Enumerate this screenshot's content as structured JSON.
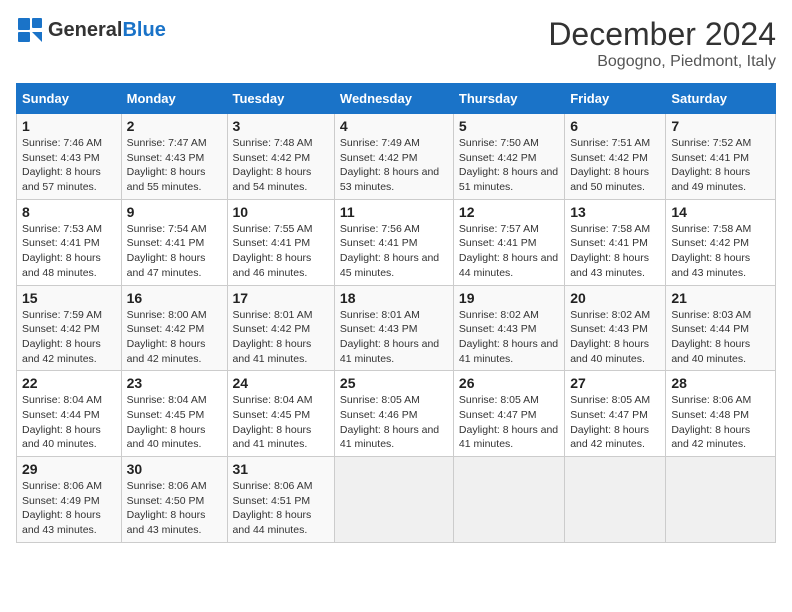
{
  "logo": {
    "text_general": "General",
    "text_blue": "Blue"
  },
  "title": "December 2024",
  "subtitle": "Bogogno, Piedmont, Italy",
  "weekdays": [
    "Sunday",
    "Monday",
    "Tuesday",
    "Wednesday",
    "Thursday",
    "Friday",
    "Saturday"
  ],
  "weeks": [
    [
      {
        "day": "1",
        "sunrise": "7:46 AM",
        "sunset": "4:43 PM",
        "daylight": "8 hours and 57 minutes."
      },
      {
        "day": "2",
        "sunrise": "7:47 AM",
        "sunset": "4:43 PM",
        "daylight": "8 hours and 55 minutes."
      },
      {
        "day": "3",
        "sunrise": "7:48 AM",
        "sunset": "4:42 PM",
        "daylight": "8 hours and 54 minutes."
      },
      {
        "day": "4",
        "sunrise": "7:49 AM",
        "sunset": "4:42 PM",
        "daylight": "8 hours and 53 minutes."
      },
      {
        "day": "5",
        "sunrise": "7:50 AM",
        "sunset": "4:42 PM",
        "daylight": "8 hours and 51 minutes."
      },
      {
        "day": "6",
        "sunrise": "7:51 AM",
        "sunset": "4:42 PM",
        "daylight": "8 hours and 50 minutes."
      },
      {
        "day": "7",
        "sunrise": "7:52 AM",
        "sunset": "4:41 PM",
        "daylight": "8 hours and 49 minutes."
      }
    ],
    [
      {
        "day": "8",
        "sunrise": "7:53 AM",
        "sunset": "4:41 PM",
        "daylight": "8 hours and 48 minutes."
      },
      {
        "day": "9",
        "sunrise": "7:54 AM",
        "sunset": "4:41 PM",
        "daylight": "8 hours and 47 minutes."
      },
      {
        "day": "10",
        "sunrise": "7:55 AM",
        "sunset": "4:41 PM",
        "daylight": "8 hours and 46 minutes."
      },
      {
        "day": "11",
        "sunrise": "7:56 AM",
        "sunset": "4:41 PM",
        "daylight": "8 hours and 45 minutes."
      },
      {
        "day": "12",
        "sunrise": "7:57 AM",
        "sunset": "4:41 PM",
        "daylight": "8 hours and 44 minutes."
      },
      {
        "day": "13",
        "sunrise": "7:58 AM",
        "sunset": "4:41 PM",
        "daylight": "8 hours and 43 minutes."
      },
      {
        "day": "14",
        "sunrise": "7:58 AM",
        "sunset": "4:42 PM",
        "daylight": "8 hours and 43 minutes."
      }
    ],
    [
      {
        "day": "15",
        "sunrise": "7:59 AM",
        "sunset": "4:42 PM",
        "daylight": "8 hours and 42 minutes."
      },
      {
        "day": "16",
        "sunrise": "8:00 AM",
        "sunset": "4:42 PM",
        "daylight": "8 hours and 42 minutes."
      },
      {
        "day": "17",
        "sunrise": "8:01 AM",
        "sunset": "4:42 PM",
        "daylight": "8 hours and 41 minutes."
      },
      {
        "day": "18",
        "sunrise": "8:01 AM",
        "sunset": "4:43 PM",
        "daylight": "8 hours and 41 minutes."
      },
      {
        "day": "19",
        "sunrise": "8:02 AM",
        "sunset": "4:43 PM",
        "daylight": "8 hours and 41 minutes."
      },
      {
        "day": "20",
        "sunrise": "8:02 AM",
        "sunset": "4:43 PM",
        "daylight": "8 hours and 40 minutes."
      },
      {
        "day": "21",
        "sunrise": "8:03 AM",
        "sunset": "4:44 PM",
        "daylight": "8 hours and 40 minutes."
      }
    ],
    [
      {
        "day": "22",
        "sunrise": "8:04 AM",
        "sunset": "4:44 PM",
        "daylight": "8 hours and 40 minutes."
      },
      {
        "day": "23",
        "sunrise": "8:04 AM",
        "sunset": "4:45 PM",
        "daylight": "8 hours and 40 minutes."
      },
      {
        "day": "24",
        "sunrise": "8:04 AM",
        "sunset": "4:45 PM",
        "daylight": "8 hours and 41 minutes."
      },
      {
        "day": "25",
        "sunrise": "8:05 AM",
        "sunset": "4:46 PM",
        "daylight": "8 hours and 41 minutes."
      },
      {
        "day": "26",
        "sunrise": "8:05 AM",
        "sunset": "4:47 PM",
        "daylight": "8 hours and 41 minutes."
      },
      {
        "day": "27",
        "sunrise": "8:05 AM",
        "sunset": "4:47 PM",
        "daylight": "8 hours and 42 minutes."
      },
      {
        "day": "28",
        "sunrise": "8:06 AM",
        "sunset": "4:48 PM",
        "daylight": "8 hours and 42 minutes."
      }
    ],
    [
      {
        "day": "29",
        "sunrise": "8:06 AM",
        "sunset": "4:49 PM",
        "daylight": "8 hours and 43 minutes."
      },
      {
        "day": "30",
        "sunrise": "8:06 AM",
        "sunset": "4:50 PM",
        "daylight": "8 hours and 43 minutes."
      },
      {
        "day": "31",
        "sunrise": "8:06 AM",
        "sunset": "4:51 PM",
        "daylight": "8 hours and 44 minutes."
      },
      null,
      null,
      null,
      null
    ]
  ]
}
